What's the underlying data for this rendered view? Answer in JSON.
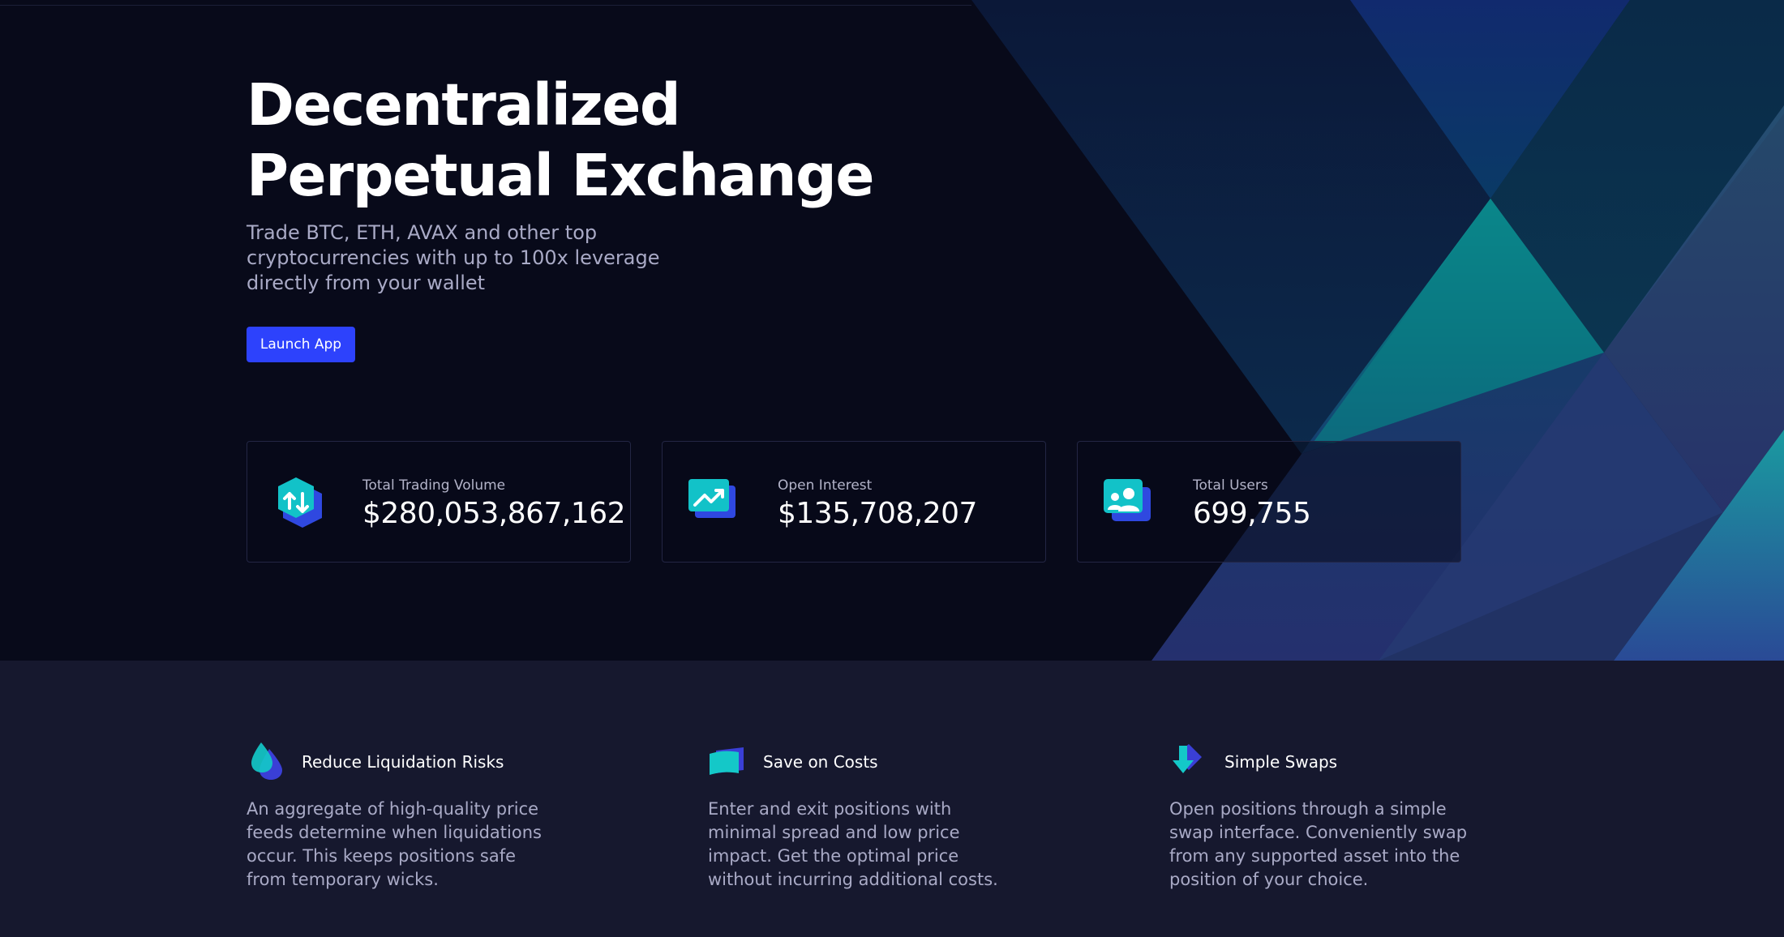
{
  "hero": {
    "title_line1": "Decentralized",
    "title_line2": "Perpetual Exchange",
    "subtitle": "Trade BTC, ETH, AVAX and other top cryptocurrencies with up to 100x leverage directly from your wallet",
    "launch_label": "Launch App"
  },
  "stats": [
    {
      "label": "Total Trading Volume",
      "value": "$280,053,867,162",
      "icon": "trading-volume-icon"
    },
    {
      "label": "Open Interest",
      "value": "$135,708,207",
      "icon": "open-interest-icon"
    },
    {
      "label": "Total Users",
      "value": "699,755",
      "icon": "users-icon"
    }
  ],
  "features": [
    {
      "title": "Reduce Liquidation Risks",
      "description": "An aggregate of high-quality price feeds determine when liquidations occur. This keeps positions safe from temporary wicks.",
      "icon": "droplet-icon"
    },
    {
      "title": "Save on Costs",
      "description": "Enter and exit positions with minimal spread and low price impact. Get the optimal price without incurring additional costs.",
      "icon": "cards-icon"
    },
    {
      "title": "Simple Swaps",
      "description": "Open positions through a simple swap interface. Conveniently swap from any supported asset into the position of your choice.",
      "icon": "swap-arrow-icon"
    }
  ],
  "colors": {
    "hero_background": "#080a1a",
    "section_background": "#16182e",
    "accent": "#2d42fc",
    "teal": "#0fb6b6",
    "text_muted": "#a9aac6"
  }
}
